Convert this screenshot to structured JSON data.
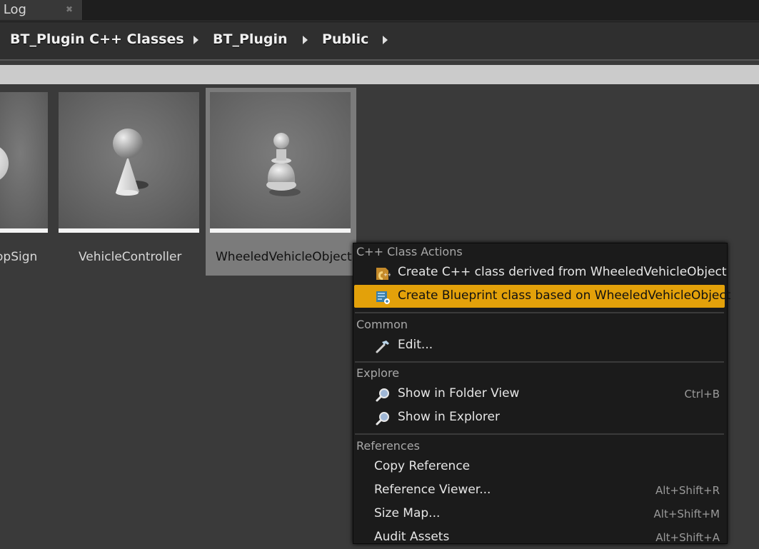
{
  "tab": {
    "label": "e Log",
    "close_icon": "close-icon"
  },
  "breadcrumb": {
    "items": [
      "BT_Plugin C++ Classes",
      "BT_Plugin",
      "Public"
    ]
  },
  "tiles": [
    {
      "label": "opSign"
    },
    {
      "label": "VehicleController"
    },
    {
      "label": "WheeledVehicleObject"
    }
  ],
  "menu": {
    "sections": {
      "cpp": "C++ Class Actions",
      "common": "Common",
      "explore": "Explore",
      "references": "References"
    },
    "items": {
      "create_cpp": {
        "label": "Create C++ class derived from WheeledVehicleObject",
        "icon": "cpp-class-icon"
      },
      "create_bp": {
        "label": "Create Blueprint class based on WheeledVehicleObject",
        "icon": "blueprint-icon"
      },
      "edit": {
        "label": "Edit...",
        "icon": "hammer-icon"
      },
      "folder_view": {
        "label": "Show in Folder View",
        "shortcut": "Ctrl+B",
        "icon": "magnifier-icon"
      },
      "explorer": {
        "label": "Show in Explorer",
        "icon": "magnifier-icon"
      },
      "copy_ref": {
        "label": "Copy Reference"
      },
      "ref_viewer": {
        "label": "Reference Viewer...",
        "shortcut": "Alt+Shift+R"
      },
      "size_map": {
        "label": "Size Map...",
        "shortcut": "Alt+Shift+M"
      },
      "audit": {
        "label": "Audit Assets",
        "shortcut": "Alt+Shift+A"
      }
    }
  },
  "colors": {
    "highlight": "#e3a10a",
    "background": "#3a3a3a",
    "menu": "#1b1b1b"
  }
}
